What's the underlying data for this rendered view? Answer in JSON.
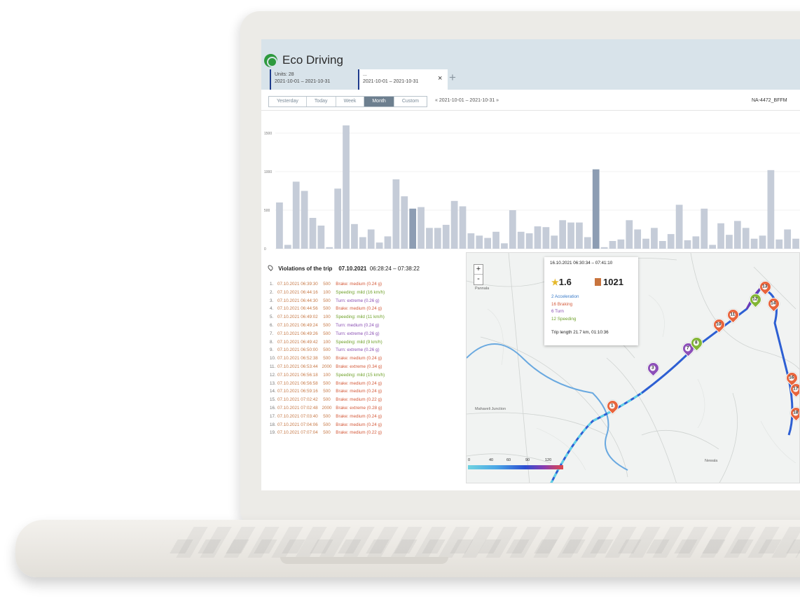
{
  "app": {
    "title": "Eco Driving"
  },
  "tabs": [
    {
      "label": "Units: 28",
      "dates": "2021-10-01 – 2021-10-31"
    },
    {
      "label": "...",
      "dates": "2021-10-01 – 2021-10-31"
    }
  ],
  "toolbar": {
    "periods": [
      "Yesterday",
      "Today",
      "Week",
      "Month",
      "Custom"
    ],
    "active_period": "Month",
    "date_range": "« 2021-10-01 – 2021-10-31 »",
    "unit_name": "NA-4472_BFFM"
  },
  "chart_data": {
    "type": "bar",
    "ylim": [
      0,
      1700
    ],
    "yticks": [
      0,
      500,
      1000,
      1500
    ],
    "values": [
      600,
      50,
      870,
      750,
      400,
      300,
      20,
      780,
      1600,
      320,
      150,
      250,
      80,
      160,
      900,
      680,
      520,
      540,
      270,
      270,
      310,
      620,
      550,
      200,
      170,
      140,
      220,
      70,
      500,
      220,
      200,
      290,
      280,
      170,
      370,
      340,
      340,
      150,
      1030,
      20,
      100,
      120,
      370,
      250,
      130,
      270,
      100,
      190,
      570,
      110,
      160,
      520,
      50,
      330,
      180,
      360,
      270,
      130,
      170,
      1020,
      120,
      250,
      130
    ]
  },
  "violations": {
    "title": "Violations of the trip",
    "trip_date": "07.10.2021",
    "trip_time": "06:28:24 – 07:38:22",
    "items": [
      {
        "n": "1.",
        "dt": "07.10.2021 06:39:30",
        "pts": "500",
        "desc": "Brake: medium (0.24 g)",
        "kind": "brake"
      },
      {
        "n": "2.",
        "dt": "07.10.2021 06:44:16",
        "pts": "100",
        "desc": "Speeding: mild (16 km/h)",
        "kind": "speed"
      },
      {
        "n": "3.",
        "dt": "07.10.2021 06:44:30",
        "pts": "500",
        "desc": "Turn: extreme (0.26 g)",
        "kind": "turn"
      },
      {
        "n": "4.",
        "dt": "07.10.2021 06:44:56",
        "pts": "500",
        "desc": "Brake: medium (0.24 g)",
        "kind": "brake"
      },
      {
        "n": "5.",
        "dt": "07.10.2021 06:49:02",
        "pts": "100",
        "desc": "Speeding: mild (11 km/h)",
        "kind": "speed"
      },
      {
        "n": "6.",
        "dt": "07.10.2021 06:49:24",
        "pts": "500",
        "desc": "Turn: medium (0.24 g)",
        "kind": "turn"
      },
      {
        "n": "7.",
        "dt": "07.10.2021 06:49:26",
        "pts": "500",
        "desc": "Turn: extreme (0.26 g)",
        "kind": "turn"
      },
      {
        "n": "8.",
        "dt": "07.10.2021 06:49:42",
        "pts": "100",
        "desc": "Speeding: mild (9 km/h)",
        "kind": "speed"
      },
      {
        "n": "9.",
        "dt": "07.10.2021 06:50:00",
        "pts": "500",
        "desc": "Turn: extreme (0.26 g)",
        "kind": "turn"
      },
      {
        "n": "10.",
        "dt": "07.10.2021 06:52:38",
        "pts": "500",
        "desc": "Brake: medium (0.24 g)",
        "kind": "brake"
      },
      {
        "n": "11.",
        "dt": "07.10.2021 06:53:44",
        "pts": "2000",
        "desc": "Brake: extreme (0.34 g)",
        "kind": "brake"
      },
      {
        "n": "12.",
        "dt": "07.10.2021 06:56:18",
        "pts": "100",
        "desc": "Speeding: mild (15 km/h)",
        "kind": "speed"
      },
      {
        "n": "13.",
        "dt": "07.10.2021 06:56:58",
        "pts": "500",
        "desc": "Brake: medium (0.24 g)",
        "kind": "brake"
      },
      {
        "n": "14.",
        "dt": "07.10.2021 06:59:16",
        "pts": "500",
        "desc": "Brake: medium (0.24 g)",
        "kind": "brake"
      },
      {
        "n": "15.",
        "dt": "07.10.2021 07:02:42",
        "pts": "500",
        "desc": "Brake: medium (0.22 g)",
        "kind": "brake"
      },
      {
        "n": "16.",
        "dt": "07.10.2021 07:02:48",
        "pts": "2000",
        "desc": "Brake: extreme (0.28 g)",
        "kind": "brake"
      },
      {
        "n": "17.",
        "dt": "07.10.2021 07:03:40",
        "pts": "500",
        "desc": "Brake: medium (0.24 g)",
        "kind": "brake"
      },
      {
        "n": "18.",
        "dt": "07.10.2021 07:04:06",
        "pts": "500",
        "desc": "Brake: medium (0.24 g)",
        "kind": "brake"
      },
      {
        "n": "19.",
        "dt": "07.10.2021 07:07:04",
        "pts": "500",
        "desc": "Brake: medium (0.22 g)",
        "kind": "brake"
      }
    ]
  },
  "map": {
    "zoom_in": "+",
    "zoom_out": "-",
    "popup": {
      "time": "16.10.2021 06:30:34 – 07:41:10",
      "rating": "1.6",
      "score": "1021",
      "acc": "2  Acceleration",
      "brk": "16  Braking",
      "trn": "6  Turn",
      "spd": "12  Speeding",
      "trip": "Trip length 21.7 km, 01:10:36"
    },
    "legend_ticks": [
      "0",
      "40",
      "60",
      "90",
      "120"
    ],
    "places": [
      "Pannala",
      "Mahaveli Junction",
      "Newala"
    ],
    "markers": [
      {
        "label": "1",
        "kind": "brake"
      },
      {
        "label": "3",
        "kind": "turn"
      },
      {
        "label": "7",
        "kind": "turn"
      },
      {
        "label": "8",
        "kind": "speed"
      },
      {
        "label": "10",
        "kind": "brake"
      },
      {
        "label": "11",
        "kind": "brake"
      },
      {
        "label": "12",
        "kind": "speed"
      },
      {
        "label": "13",
        "kind": "brake"
      },
      {
        "label": "14",
        "kind": "brake"
      },
      {
        "label": "16",
        "kind": "brake"
      },
      {
        "label": "17",
        "kind": "brake"
      },
      {
        "label": "18",
        "kind": "brake"
      }
    ]
  },
  "colors": {
    "header": "#d8e3ea",
    "bar": "#c5ccd8",
    "bar_highlight": "#8d9db3",
    "brake": "#e8643c",
    "speed": "#82b534",
    "turn": "#8c4fb8"
  }
}
